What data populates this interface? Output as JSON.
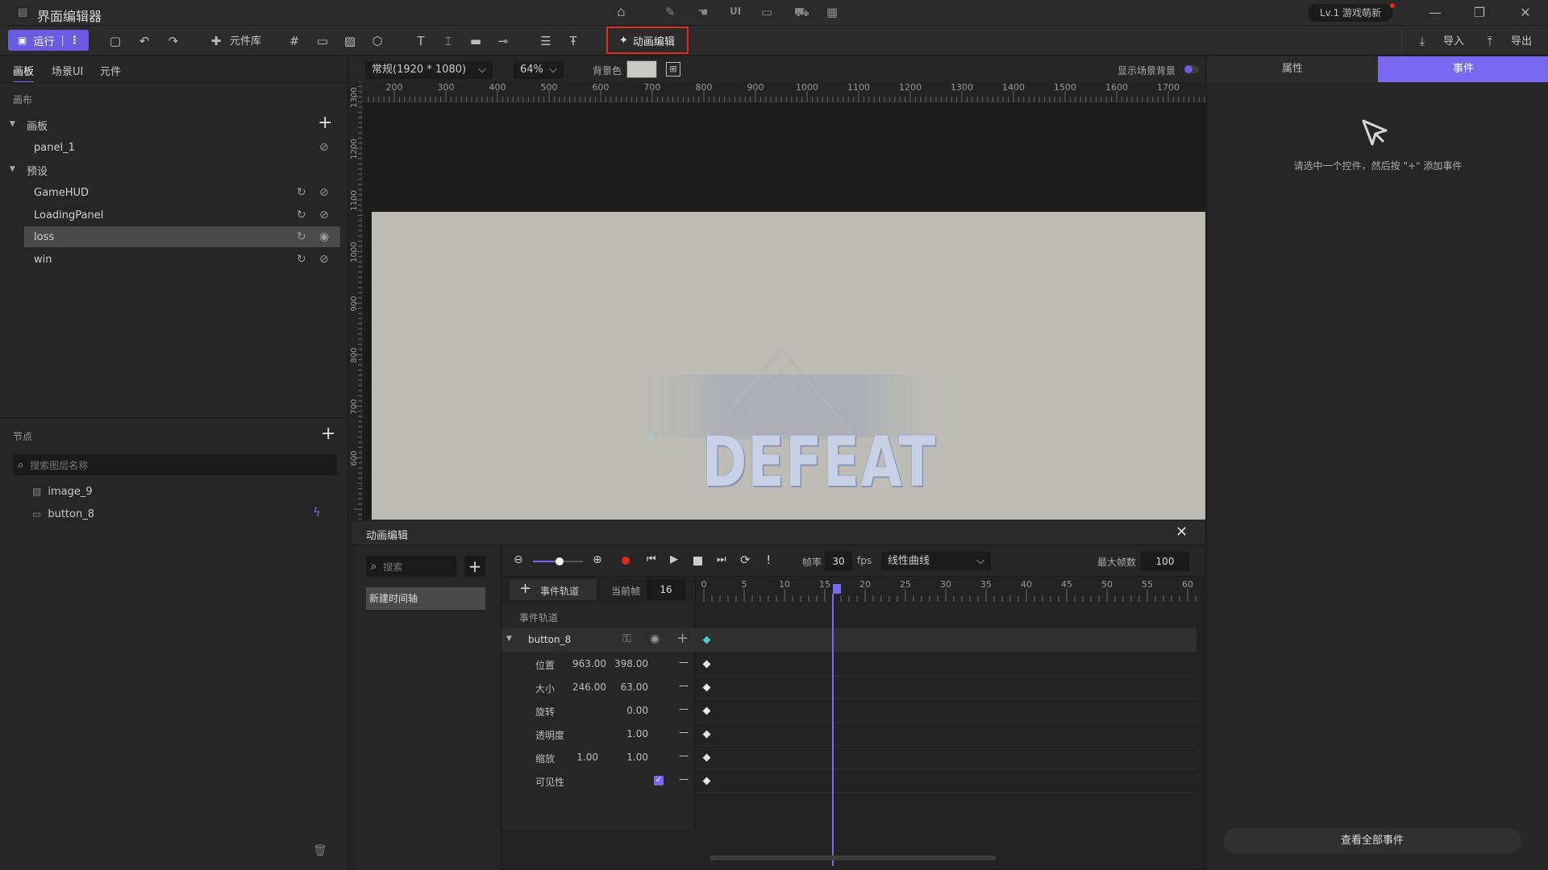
{
  "titlebar": {
    "app_title": "界面编辑器",
    "level_badge": "Lv.1 游戏萌新",
    "minimize": "—",
    "restore": "❐",
    "close": "✕"
  },
  "toolbar": {
    "run_label": "运行",
    "library_label": "元件库",
    "anim_editor_label": "动画编辑",
    "import_label": "导入",
    "export_label": "导出"
  },
  "left_panel": {
    "tabs": [
      "画板",
      "场景UI",
      "元件"
    ],
    "canvas_section": "画布",
    "board_group": "画板",
    "board_items": [
      "panel_1"
    ],
    "preset_group": "预设",
    "preset_items": [
      "GameHUD",
      "LoadingPanel",
      "loss",
      "win"
    ],
    "selected_preset": "loss",
    "nodes_section": "节点",
    "search_placeholder": "搜索图层名称",
    "nodes": [
      "image_9",
      "button_8"
    ]
  },
  "canvas_bar": {
    "resolution": "常规(1920 * 1080)",
    "zoom": "64%",
    "bg_label": "背景色",
    "show_scene_bg": "显示场景背景"
  },
  "ruler_top": [
    "200",
    "300",
    "400",
    "500",
    "600",
    "700",
    "800",
    "900",
    "1000",
    "1100",
    "1200",
    "1300",
    "1400",
    "1500",
    "1600",
    "1700"
  ],
  "ruler_left": [
    "1300",
    "1200",
    "1100",
    "1000",
    "900",
    "800",
    "700",
    "600"
  ],
  "stage": {
    "defeat_text": "DEFEAT",
    "bg_color": "#bdbcb6"
  },
  "right_panel": {
    "tab_props": "属性",
    "tab_events": "事件",
    "hint": "请选中一个控件，然后按 \"+\" 添加事件",
    "view_all": "查看全部事件"
  },
  "anim_editor": {
    "title": "动画编辑",
    "search_placeholder": "搜索",
    "timeline_name": "新建时间轴",
    "event_track_btn": "事件轨道",
    "current_frame_label": "当前帧",
    "current_frame": "16",
    "frame_rate_label": "帧率",
    "frame_rate": "30",
    "fps_unit": "fps",
    "curve": "线性曲线",
    "max_frames_label": "最大帧数",
    "max_frames": "100",
    "event_track_label": "事件轨道",
    "node_name": "button_8",
    "ticks": [
      "0",
      "5",
      "10",
      "15",
      "20",
      "25",
      "30",
      "35",
      "40",
      "45",
      "50",
      "55",
      "60"
    ],
    "props": [
      {
        "label": "位置",
        "v1": "963.00",
        "v2": "398.00"
      },
      {
        "label": "大小",
        "v1": "246.00",
        "v2": "63.00"
      },
      {
        "label": "旋转",
        "v1": "",
        "v2": "0.00"
      },
      {
        "label": "透明度",
        "v1": "",
        "v2": "1.00"
      },
      {
        "label": "缩放",
        "v1": "1.00",
        "v2": "1.00"
      },
      {
        "label": "可见性",
        "v1": "",
        "v2": ""
      }
    ]
  },
  "colors": {
    "accent": "#6c5ae0",
    "highlight": "#e0281e",
    "playhead": "#7a68f0",
    "key_cyan": "#3fd0c8"
  }
}
